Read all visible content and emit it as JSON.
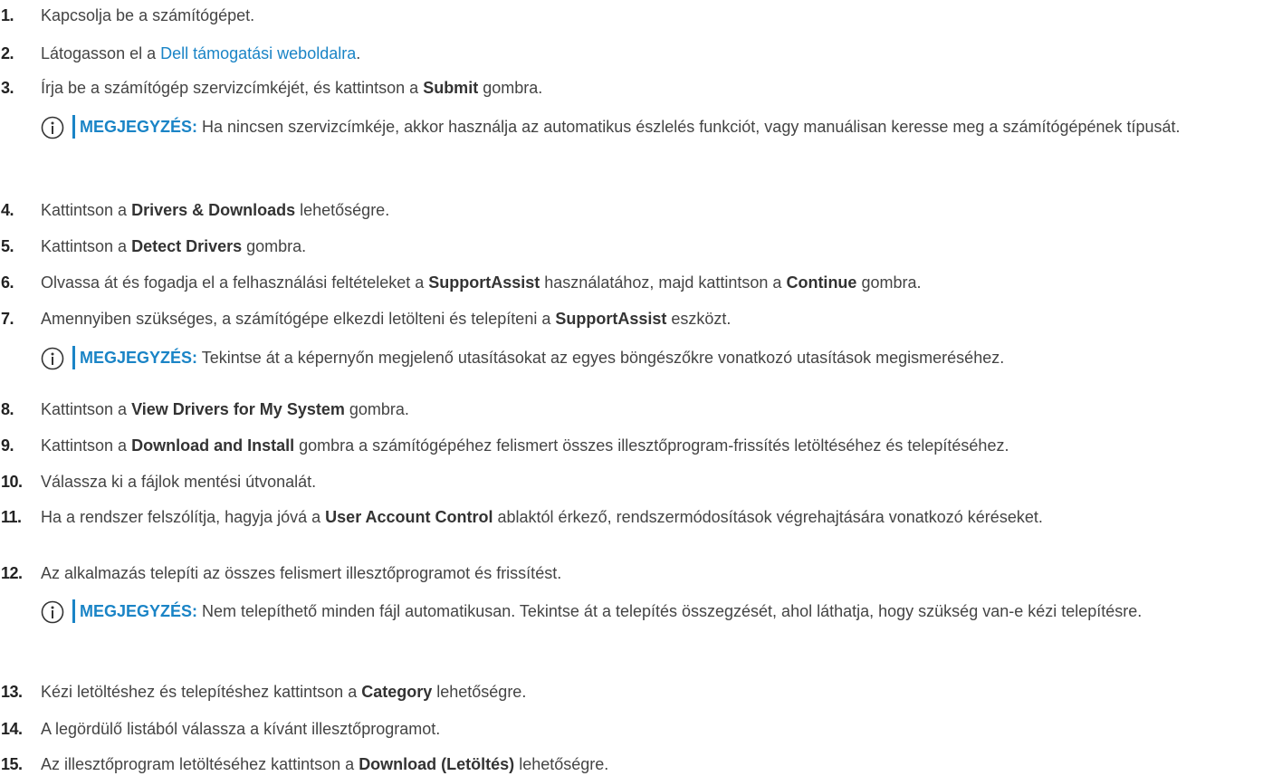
{
  "steps": [
    {
      "num": "1.",
      "parts": [
        {
          "t": "Kapcsolja be a számítógépet."
        }
      ]
    },
    {
      "num": "2.",
      "parts": [
        {
          "t": "Látogasson el a "
        },
        {
          "t": "Dell támogatási weboldalra",
          "link": true
        },
        {
          "t": "."
        }
      ]
    },
    {
      "num": "3.",
      "parts": [
        {
          "t": "Írja be a számítógép szervizcímkéjét, és kattintson a "
        },
        {
          "t": "Submit",
          "bold": true
        },
        {
          "t": " gombra."
        }
      ]
    },
    {
      "note": {
        "label": "MEGJEGYZÉS:",
        "text": " Ha nincsen szervizcímkéje, akkor használja az automatikus észlelés funkciót, vagy manuálisan keresse meg a számítógépének típusát."
      }
    },
    {
      "num": "4.",
      "parts": [
        {
          "t": "Kattintson a "
        },
        {
          "t": "Drivers & Downloads",
          "bold": true
        },
        {
          "t": " lehetőségre."
        }
      ]
    },
    {
      "num": "5.",
      "parts": [
        {
          "t": "Kattintson a "
        },
        {
          "t": "Detect Drivers",
          "bold": true
        },
        {
          "t": " gombra."
        }
      ]
    },
    {
      "num": "6.",
      "parts": [
        {
          "t": "Olvassa át és fogadja el a felhasználási feltételeket a "
        },
        {
          "t": "SupportAssist",
          "bold": true
        },
        {
          "t": " használatához, majd kattintson a "
        },
        {
          "t": "Continue",
          "bold": true
        },
        {
          "t": " gombra."
        }
      ]
    },
    {
      "num": "7.",
      "parts": [
        {
          "t": "Amennyiben szükséges, a számítógépe elkezdi letölteni és telepíteni a "
        },
        {
          "t": "SupportAssist",
          "bold": true
        },
        {
          "t": " eszközt."
        }
      ]
    },
    {
      "note": {
        "label": "MEGJEGYZÉS:",
        "text": " Tekintse át a képernyőn megjelenő utasításokat az egyes böngészőkre vonatkozó utasítások megismeréséhez."
      }
    },
    {
      "num": "8.",
      "parts": [
        {
          "t": "Kattintson a "
        },
        {
          "t": "View Drivers for My System",
          "bold": true
        },
        {
          "t": " gombra."
        }
      ]
    },
    {
      "num": "9.",
      "parts": [
        {
          "t": "Kattintson a "
        },
        {
          "t": "Download and Install",
          "bold": true
        },
        {
          "t": " gombra a számítógépéhez felismert összes illesztőprogram-frissítés letöltéséhez és telepítéséhez."
        }
      ]
    },
    {
      "num": "10.",
      "parts": [
        {
          "t": "Válassza ki a fájlok mentési útvonalát."
        }
      ]
    },
    {
      "num": "11.",
      "parts": [
        {
          "t": "Ha a rendszer felszólítja, hagyja jóvá a "
        },
        {
          "t": "User Account Control",
          "bold": true
        },
        {
          "t": " ablaktól érkező, rendszermódosítások végrehajtására vonatkozó kéréseket."
        }
      ]
    },
    {
      "num": "12.",
      "parts": [
        {
          "t": "Az alkalmazás telepíti az összes felismert illesztőprogramot és frissítést."
        }
      ]
    },
    {
      "note": {
        "label": "MEGJEGYZÉS:",
        "text": " Nem telepíthető minden fájl automatikusan. Tekintse át a telepítés összegzését, ahol láthatja, hogy szükség van-e kézi telepítésre."
      }
    },
    {
      "num": "13.",
      "parts": [
        {
          "t": "Kézi letöltéshez és telepítéshez kattintson a "
        },
        {
          "t": "Category",
          "bold": true
        },
        {
          "t": " lehetőségre."
        }
      ]
    },
    {
      "num": "14.",
      "parts": [
        {
          "t": "A legördülő listából válassza a kívánt illesztőprogramot."
        }
      ]
    },
    {
      "num": "15.",
      "parts": [
        {
          "t": "Az illesztőprogram letöltéséhez kattintson a "
        },
        {
          "t": "Download (Letöltés)",
          "bold": true
        },
        {
          "t": " lehetőségre."
        }
      ]
    }
  ],
  "colors": {
    "accent": "#1a84c6",
    "text": "#444444"
  },
  "icons": {
    "note": "info-icon"
  }
}
